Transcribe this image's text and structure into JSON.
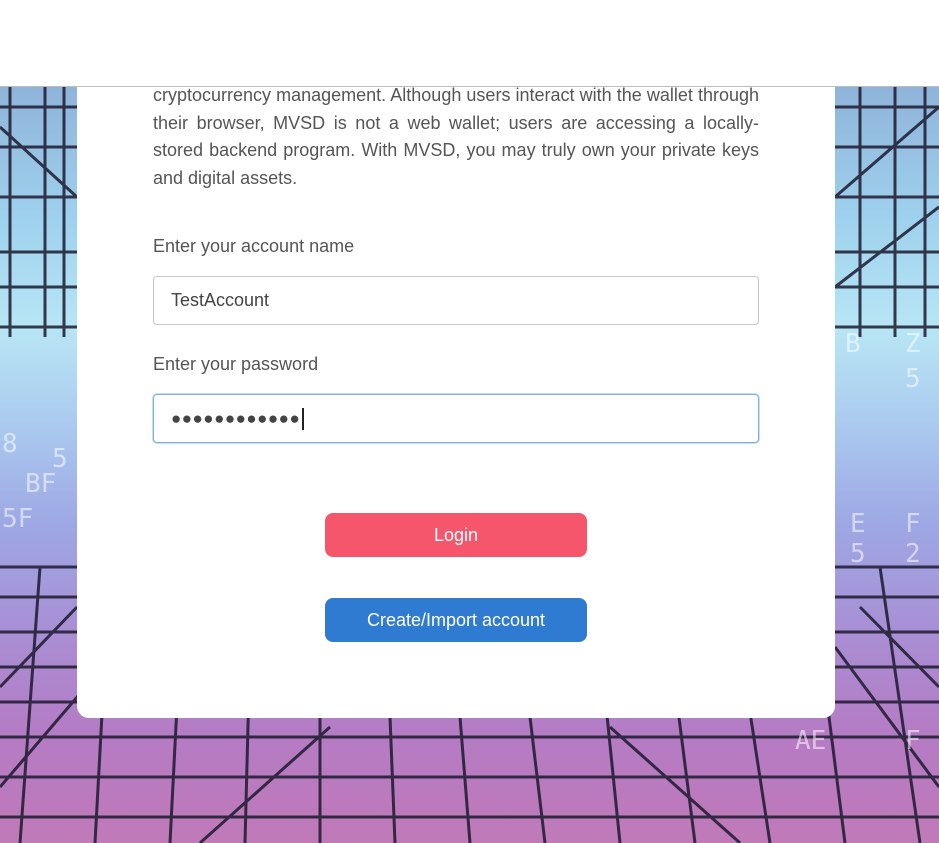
{
  "intro_text": "cryptocurrency management. Although users interact with the wallet through their browser, MVSD is not a web wallet; users are accessing a locally-stored backend program. With MVSD, you may truly own your private keys and digital assets.",
  "account": {
    "label": "Enter your account name",
    "value": "TestAccount"
  },
  "password": {
    "label": "Enter your password",
    "masked_value": "●●●●●●●●●●●●"
  },
  "buttons": {
    "login": "Login",
    "create_import": "Create/Import account"
  },
  "colors": {
    "login_button": "#f5566c",
    "create_button": "#2f7bd2",
    "focus_border": "#7fb1e2"
  }
}
